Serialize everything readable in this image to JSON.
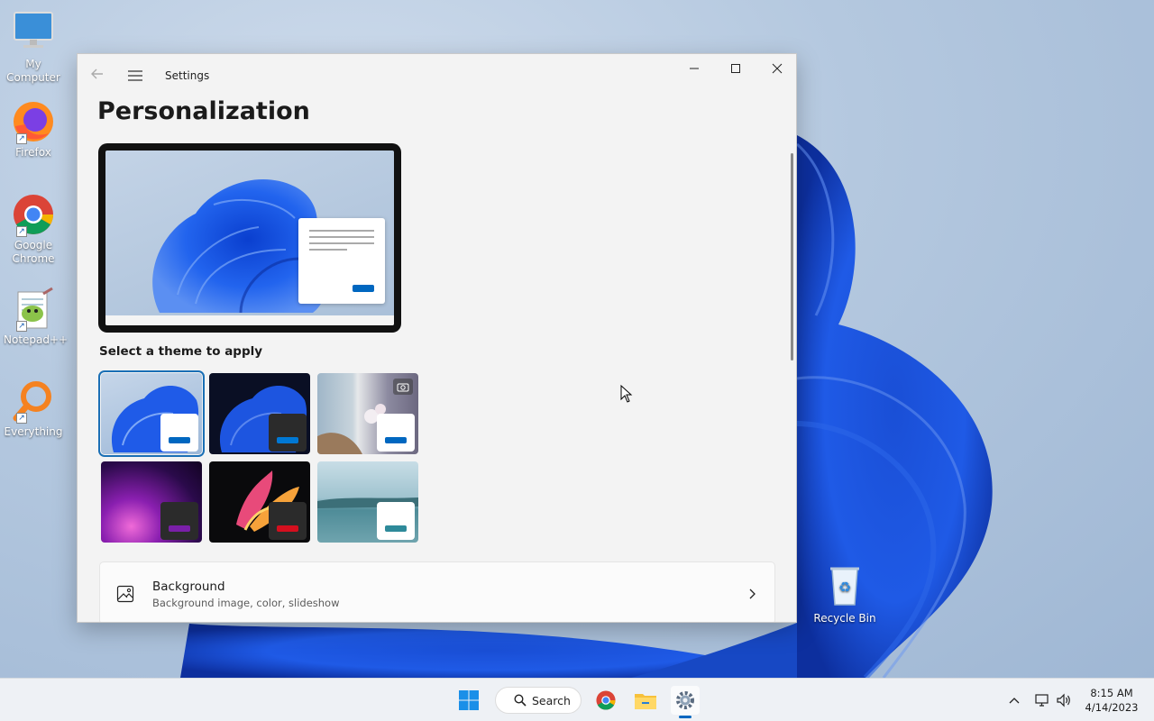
{
  "desktop": {
    "icons": [
      {
        "label": "My Computer",
        "icon": "monitor-icon"
      },
      {
        "label": "Firefox",
        "icon": "firefox-icon"
      },
      {
        "label": "Google Chrome",
        "icon": "chrome-icon"
      },
      {
        "label": "Notepad++",
        "icon": "notepadpp-icon"
      },
      {
        "label": "Everything",
        "icon": "everything-search-icon"
      }
    ],
    "recycle_bin": "Recycle Bin"
  },
  "window": {
    "app_title": "Settings",
    "page_title": "Personalization",
    "theme_heading": "Select a theme to apply",
    "themes": [
      {
        "name": "windows-light",
        "selected": true
      },
      {
        "name": "windows-dark",
        "selected": false
      },
      {
        "name": "windows-spotlight",
        "selected": false
      },
      {
        "name": "glow",
        "selected": false
      },
      {
        "name": "captured-motion",
        "selected": false
      },
      {
        "name": "flow",
        "selected": false
      }
    ],
    "background_card": {
      "title": "Background",
      "subtitle": "Background image, color, slideshow"
    }
  },
  "taskbar": {
    "search_label": "Search",
    "time": "8:15 AM",
    "date": "4/14/2023"
  },
  "colors": {
    "accent": "#0067c0",
    "window_bg": "#f3f3f3",
    "bloom": "#1f5ae6"
  }
}
